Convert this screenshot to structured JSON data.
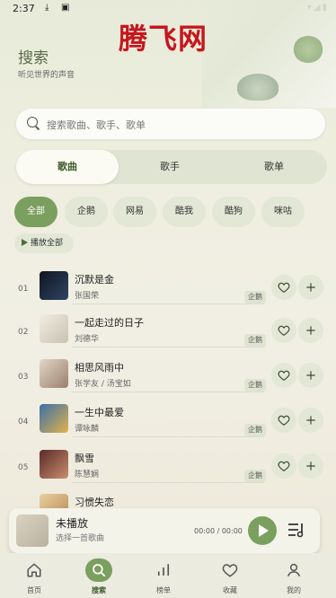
{
  "status_bar": {
    "time": "2:37",
    "icons": [
      "download-icon",
      "notification-icon",
      "wifi-icon",
      "signal-icon",
      "battery-icon"
    ]
  },
  "header": {
    "logo": "腾飞网",
    "title": "搜索",
    "subtitle": "听见世界的声音"
  },
  "search": {
    "placeholder": "搜索歌曲、歌手、歌单"
  },
  "tabs": [
    {
      "label": "歌曲",
      "active": true
    },
    {
      "label": "歌手",
      "active": false
    },
    {
      "label": "歌单",
      "active": false
    }
  ],
  "filters": [
    {
      "label": "全部",
      "active": true
    },
    {
      "label": "企鹅"
    },
    {
      "label": "网易"
    },
    {
      "label": "酷我"
    },
    {
      "label": "酷狗"
    },
    {
      "label": "咪咕"
    }
  ],
  "play_all_label": "播放全部",
  "songs": [
    {
      "index": "01",
      "title": "沉默是金",
      "artist": "张国荣",
      "source": "企鹅",
      "cover_color": "#1e2a3a"
    },
    {
      "index": "02",
      "title": "一起走过的日子",
      "artist": "刘德华",
      "source": "企鹅",
      "cover_color": "#e8e3d6"
    },
    {
      "index": "03",
      "title": "相思风雨中",
      "artist": "张学友 / 汤宝如",
      "source": "企鹅",
      "cover_color": "#c9b7a6"
    },
    {
      "index": "04",
      "title": "一生中最爱",
      "artist": "谭咏麟",
      "source": "企鹅",
      "cover_color": "#c89540"
    },
    {
      "index": "05",
      "title": "飘雪",
      "artist": "陈慧娴",
      "source": "企鹅",
      "cover_color": "#7a3f3a"
    },
    {
      "index": "06",
      "title": "习惯失恋",
      "artist": "",
      "source": "",
      "cover_color": "#d6b98a"
    }
  ],
  "player": {
    "title": "未播放",
    "subtitle": "选择一首歌曲",
    "time": "00:00 / 00:00"
  },
  "nav": [
    {
      "label": "首页",
      "icon": "home-icon"
    },
    {
      "label": "搜索",
      "icon": "search-icon",
      "active": true
    },
    {
      "label": "榜单",
      "icon": "chart-icon"
    },
    {
      "label": "收藏",
      "icon": "heart-icon"
    },
    {
      "label": "我的",
      "icon": "user-icon"
    }
  ],
  "colors": {
    "accent": "#7b9f5e",
    "chip_bg": "#e2e7d6",
    "logo": "#c6161d"
  }
}
